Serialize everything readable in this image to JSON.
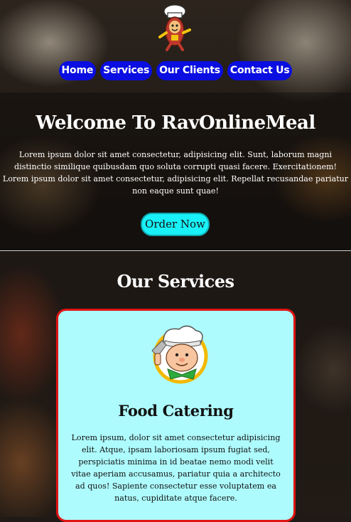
{
  "nav": {
    "items": [
      {
        "label": "Home"
      },
      {
        "label": "Services"
      },
      {
        "label": "Our Clients"
      },
      {
        "label": "Contact Us"
      }
    ]
  },
  "hero": {
    "title": "Welcome To RavOnlineMeal",
    "text": "Lorem ipsum dolor sit amet consectetur, adipisicing elit. Sunt, laborum magni distinctio similique quibusdam quo soluta corrupti quasi facere. Exercitationem! Lorem ipsum dolor sit amet consectetur, adipisicing elit. Repellat recusandae pariatur non eaque sunt quae!",
    "order_label": "Order Now"
  },
  "services": {
    "title": "Our Services",
    "cards": [
      {
        "icon": "chef-icon",
        "title": "Food Catering",
        "text": "Lorem ipsum, dolor sit amet consectetur adipisicing elit. Atque, ipsam laboriosam ipsum fugiat sed, perspiciatis minima in id beatae nemo modi velit vitae aperiam accusamus, pariatur quia a architecto ad quos! Sapiente consectetur esse voluptatem ea natus, cupiditate atque facere."
      }
    ]
  },
  "colors": {
    "nav_bg": "#0a0ee0",
    "order_button": "#18f1f7",
    "card_bg": "#aefbfd",
    "card_border": "#e01313"
  }
}
